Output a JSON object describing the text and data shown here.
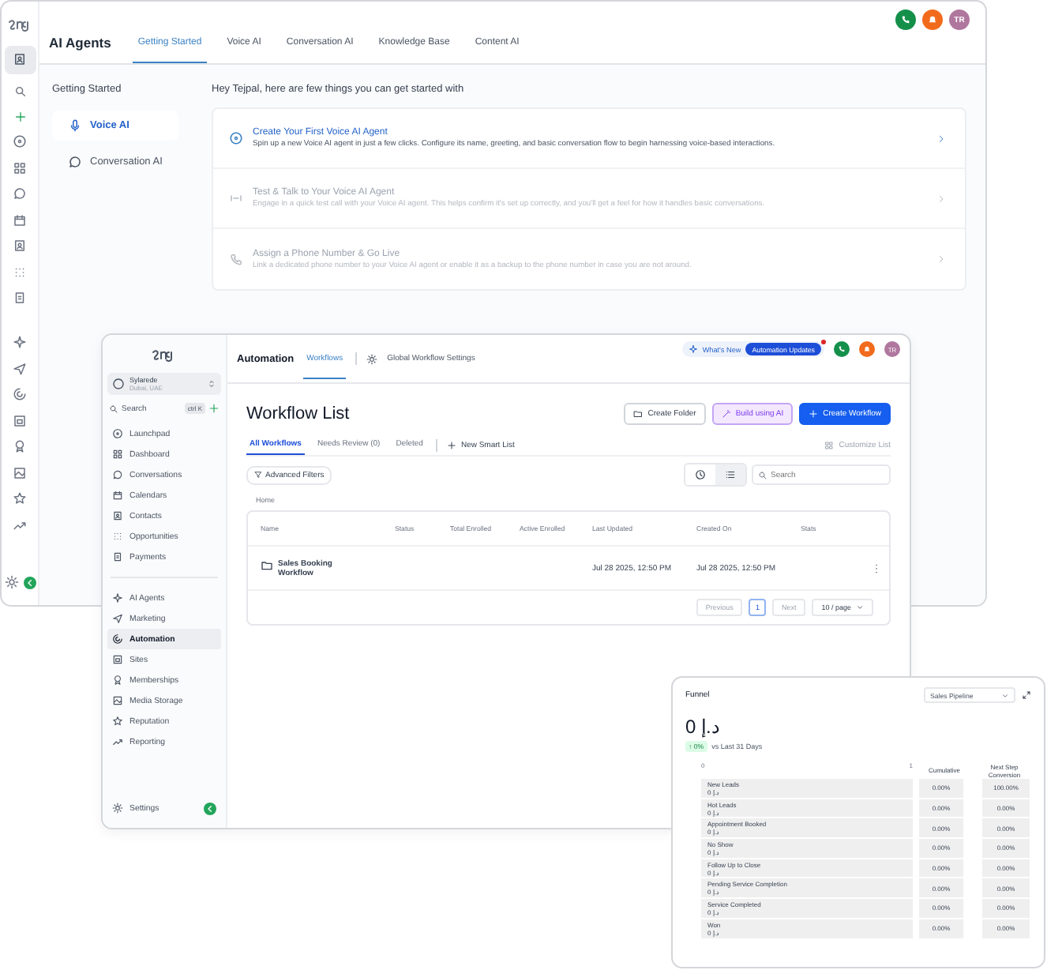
{
  "ai_agents_window": {
    "title": "AI Agents",
    "tabs": [
      {
        "label": "Getting Started",
        "selected": true
      },
      {
        "label": "Voice AI",
        "selected": false
      },
      {
        "label": "Conversation AI",
        "selected": false
      },
      {
        "label": "Knowledge Base",
        "selected": false
      },
      {
        "label": "Content AI",
        "selected": false
      }
    ],
    "avatar": "TR",
    "side_heading": "Getting Started",
    "side_items": [
      {
        "label": "Voice AI",
        "selected": true
      },
      {
        "label": "Conversation AI",
        "selected": false
      }
    ],
    "greeting": "Hey Tejpal, here are few things you can get started with",
    "steps": [
      {
        "title": "Create Your First Voice AI Agent",
        "description": "Spin up a new Voice AI agent in just a few clicks. Configure its name, greeting, and basic conversation flow to begin harnessing voice-based interactions.",
        "disabled": false
      },
      {
        "title": "Test & Talk to Your Voice AI Agent",
        "description": "Engage in a quick test call with your Voice AI agent. This helps confirm it's set up correctly, and you'll get a feel for how it handles basic conversations.",
        "disabled": true
      },
      {
        "title": "Assign a Phone Number & Go Live",
        "description": "Link a dedicated phone number to your Voice AI agent or enable it as a backup to the phone number in case you are not around.",
        "disabled": true
      }
    ]
  },
  "workflow_window": {
    "account": {
      "name": "Sylarede",
      "location": "Dubai, UAE"
    },
    "search": {
      "placeholder": "Search",
      "shortcut": "ctrl K"
    },
    "nav": [
      {
        "label": "Launchpad",
        "selected": false
      },
      {
        "label": "Dashboard",
        "selected": false
      },
      {
        "label": "Conversations",
        "selected": false
      },
      {
        "label": "Calendars",
        "selected": false
      },
      {
        "label": "Contacts",
        "selected": false
      },
      {
        "label": "Opportunities",
        "selected": false
      },
      {
        "label": "Payments",
        "selected": false
      }
    ],
    "nav_secondary": [
      {
        "label": "AI Agents",
        "selected": false
      },
      {
        "label": "Marketing",
        "selected": false
      },
      {
        "label": "Automation",
        "selected": true
      },
      {
        "label": "Sites",
        "selected": false
      },
      {
        "label": "Memberships",
        "selected": false
      },
      {
        "label": "Media Storage",
        "selected": false
      },
      {
        "label": "Reputation",
        "selected": false
      },
      {
        "label": "Reporting",
        "selected": false
      }
    ],
    "settings": "Settings",
    "section": "Automation",
    "tabs": [
      {
        "label": "Workflows",
        "selected": true
      }
    ],
    "settings_link": "Global Workflow Settings",
    "whats_new": "What's New",
    "updates_badge": "Automation Updates",
    "avatar": "TR",
    "title": "Workflow List",
    "buttons": [
      {
        "label": "Create Folder",
        "kind": "outline"
      },
      {
        "label": "Build using AI",
        "kind": "ai"
      },
      {
        "label": "Create Workflow",
        "kind": "primary"
      }
    ],
    "list_tabs": [
      {
        "label": "All Workflows",
        "selected": true
      },
      {
        "label": "Needs Review (0)",
        "selected": false
      },
      {
        "label": "Deleted",
        "selected": false
      }
    ],
    "new_smart_list": "New Smart List",
    "customize": "Customize List",
    "filters": "Advanced Filters",
    "view_toggle": [
      {
        "kind": "clock",
        "selected": false
      },
      {
        "kind": "list",
        "selected": true
      }
    ],
    "table_search": {
      "placeholder": "Search"
    },
    "breadcrumb": "Home",
    "columns": [
      "Name",
      "Status",
      "Total Enrolled",
      "Active Enrolled",
      "Last Updated",
      "Created On",
      "Stats"
    ],
    "rows": [
      {
        "name": "Sales Booking Workflow",
        "last_updated": "Jul 28 2025, 12:50 PM",
        "created_on": "Jul 28 2025, 12:50 PM"
      }
    ],
    "pagination": {
      "previous": "Previous",
      "pages": [
        {
          "label": "1",
          "selected": true
        }
      ],
      "next": "Next",
      "page_size": "10 / page"
    }
  },
  "funnel_window": {
    "title": "Funnel",
    "pipeline": "Sales Pipeline",
    "total": "0 د.إ",
    "change": "↑ 0%",
    "comparison": "vs Last 31 Days",
    "axis": [
      "0",
      "1"
    ],
    "columns": [
      "Cumulative",
      "Next Step Conversion"
    ],
    "stages": [
      {
        "name": "New Leads",
        "value": "0 د.إ",
        "cumulative": "0.00%",
        "next_step": "100.00%"
      },
      {
        "name": "Hot Leads",
        "value": "0 د.إ",
        "cumulative": "0.00%",
        "next_step": "0.00%"
      },
      {
        "name": "Appointment Booked",
        "value": "0 د.إ",
        "cumulative": "0.00%",
        "next_step": "0.00%"
      },
      {
        "name": "No Show",
        "value": "0 د.إ",
        "cumulative": "0.00%",
        "next_step": "0.00%"
      },
      {
        "name": "Follow Up to Close",
        "value": "0 د.إ",
        "cumulative": "0.00%",
        "next_step": "0.00%"
      },
      {
        "name": "Pending Service Completion",
        "value": "0 د.إ",
        "cumulative": "0.00%",
        "next_step": "0.00%"
      },
      {
        "name": "Service Completed",
        "value": "0 د.إ",
        "cumulative": "0.00%",
        "next_step": "0.00%"
      },
      {
        "name": "Won",
        "value": "0 د.إ",
        "cumulative": "0.00%",
        "next_step": "0.00%"
      }
    ]
  }
}
